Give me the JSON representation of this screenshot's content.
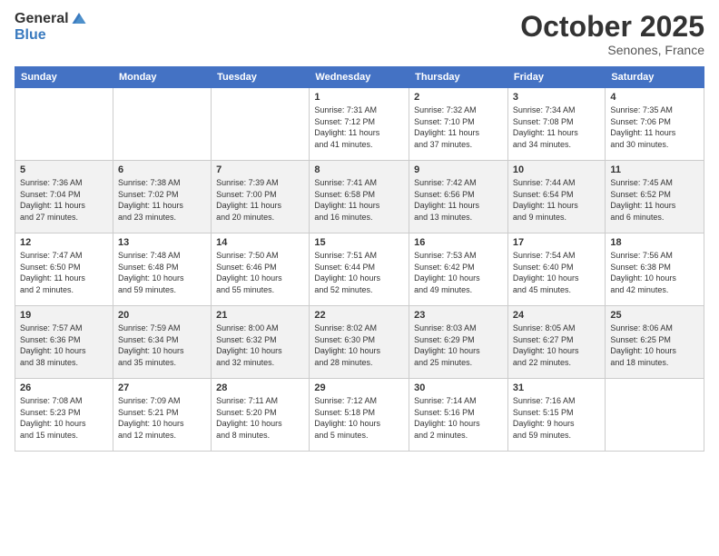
{
  "logo": {
    "general": "General",
    "blue": "Blue"
  },
  "title": "October 2025",
  "location": "Senones, France",
  "days_header": [
    "Sunday",
    "Monday",
    "Tuesday",
    "Wednesday",
    "Thursday",
    "Friday",
    "Saturday"
  ],
  "weeks": [
    [
      {
        "num": "",
        "info": ""
      },
      {
        "num": "",
        "info": ""
      },
      {
        "num": "",
        "info": ""
      },
      {
        "num": "1",
        "info": "Sunrise: 7:31 AM\nSunset: 7:12 PM\nDaylight: 11 hours\nand 41 minutes."
      },
      {
        "num": "2",
        "info": "Sunrise: 7:32 AM\nSunset: 7:10 PM\nDaylight: 11 hours\nand 37 minutes."
      },
      {
        "num": "3",
        "info": "Sunrise: 7:34 AM\nSunset: 7:08 PM\nDaylight: 11 hours\nand 34 minutes."
      },
      {
        "num": "4",
        "info": "Sunrise: 7:35 AM\nSunset: 7:06 PM\nDaylight: 11 hours\nand 30 minutes."
      }
    ],
    [
      {
        "num": "5",
        "info": "Sunrise: 7:36 AM\nSunset: 7:04 PM\nDaylight: 11 hours\nand 27 minutes."
      },
      {
        "num": "6",
        "info": "Sunrise: 7:38 AM\nSunset: 7:02 PM\nDaylight: 11 hours\nand 23 minutes."
      },
      {
        "num": "7",
        "info": "Sunrise: 7:39 AM\nSunset: 7:00 PM\nDaylight: 11 hours\nand 20 minutes."
      },
      {
        "num": "8",
        "info": "Sunrise: 7:41 AM\nSunset: 6:58 PM\nDaylight: 11 hours\nand 16 minutes."
      },
      {
        "num": "9",
        "info": "Sunrise: 7:42 AM\nSunset: 6:56 PM\nDaylight: 11 hours\nand 13 minutes."
      },
      {
        "num": "10",
        "info": "Sunrise: 7:44 AM\nSunset: 6:54 PM\nDaylight: 11 hours\nand 9 minutes."
      },
      {
        "num": "11",
        "info": "Sunrise: 7:45 AM\nSunset: 6:52 PM\nDaylight: 11 hours\nand 6 minutes."
      }
    ],
    [
      {
        "num": "12",
        "info": "Sunrise: 7:47 AM\nSunset: 6:50 PM\nDaylight: 11 hours\nand 2 minutes."
      },
      {
        "num": "13",
        "info": "Sunrise: 7:48 AM\nSunset: 6:48 PM\nDaylight: 10 hours\nand 59 minutes."
      },
      {
        "num": "14",
        "info": "Sunrise: 7:50 AM\nSunset: 6:46 PM\nDaylight: 10 hours\nand 55 minutes."
      },
      {
        "num": "15",
        "info": "Sunrise: 7:51 AM\nSunset: 6:44 PM\nDaylight: 10 hours\nand 52 minutes."
      },
      {
        "num": "16",
        "info": "Sunrise: 7:53 AM\nSunset: 6:42 PM\nDaylight: 10 hours\nand 49 minutes."
      },
      {
        "num": "17",
        "info": "Sunrise: 7:54 AM\nSunset: 6:40 PM\nDaylight: 10 hours\nand 45 minutes."
      },
      {
        "num": "18",
        "info": "Sunrise: 7:56 AM\nSunset: 6:38 PM\nDaylight: 10 hours\nand 42 minutes."
      }
    ],
    [
      {
        "num": "19",
        "info": "Sunrise: 7:57 AM\nSunset: 6:36 PM\nDaylight: 10 hours\nand 38 minutes."
      },
      {
        "num": "20",
        "info": "Sunrise: 7:59 AM\nSunset: 6:34 PM\nDaylight: 10 hours\nand 35 minutes."
      },
      {
        "num": "21",
        "info": "Sunrise: 8:00 AM\nSunset: 6:32 PM\nDaylight: 10 hours\nand 32 minutes."
      },
      {
        "num": "22",
        "info": "Sunrise: 8:02 AM\nSunset: 6:30 PM\nDaylight: 10 hours\nand 28 minutes."
      },
      {
        "num": "23",
        "info": "Sunrise: 8:03 AM\nSunset: 6:29 PM\nDaylight: 10 hours\nand 25 minutes."
      },
      {
        "num": "24",
        "info": "Sunrise: 8:05 AM\nSunset: 6:27 PM\nDaylight: 10 hours\nand 22 minutes."
      },
      {
        "num": "25",
        "info": "Sunrise: 8:06 AM\nSunset: 6:25 PM\nDaylight: 10 hours\nand 18 minutes."
      }
    ],
    [
      {
        "num": "26",
        "info": "Sunrise: 7:08 AM\nSunset: 5:23 PM\nDaylight: 10 hours\nand 15 minutes."
      },
      {
        "num": "27",
        "info": "Sunrise: 7:09 AM\nSunset: 5:21 PM\nDaylight: 10 hours\nand 12 minutes."
      },
      {
        "num": "28",
        "info": "Sunrise: 7:11 AM\nSunset: 5:20 PM\nDaylight: 10 hours\nand 8 minutes."
      },
      {
        "num": "29",
        "info": "Sunrise: 7:12 AM\nSunset: 5:18 PM\nDaylight: 10 hours\nand 5 minutes."
      },
      {
        "num": "30",
        "info": "Sunrise: 7:14 AM\nSunset: 5:16 PM\nDaylight: 10 hours\nand 2 minutes."
      },
      {
        "num": "31",
        "info": "Sunrise: 7:16 AM\nSunset: 5:15 PM\nDaylight: 9 hours\nand 59 minutes."
      },
      {
        "num": "",
        "info": ""
      }
    ]
  ]
}
